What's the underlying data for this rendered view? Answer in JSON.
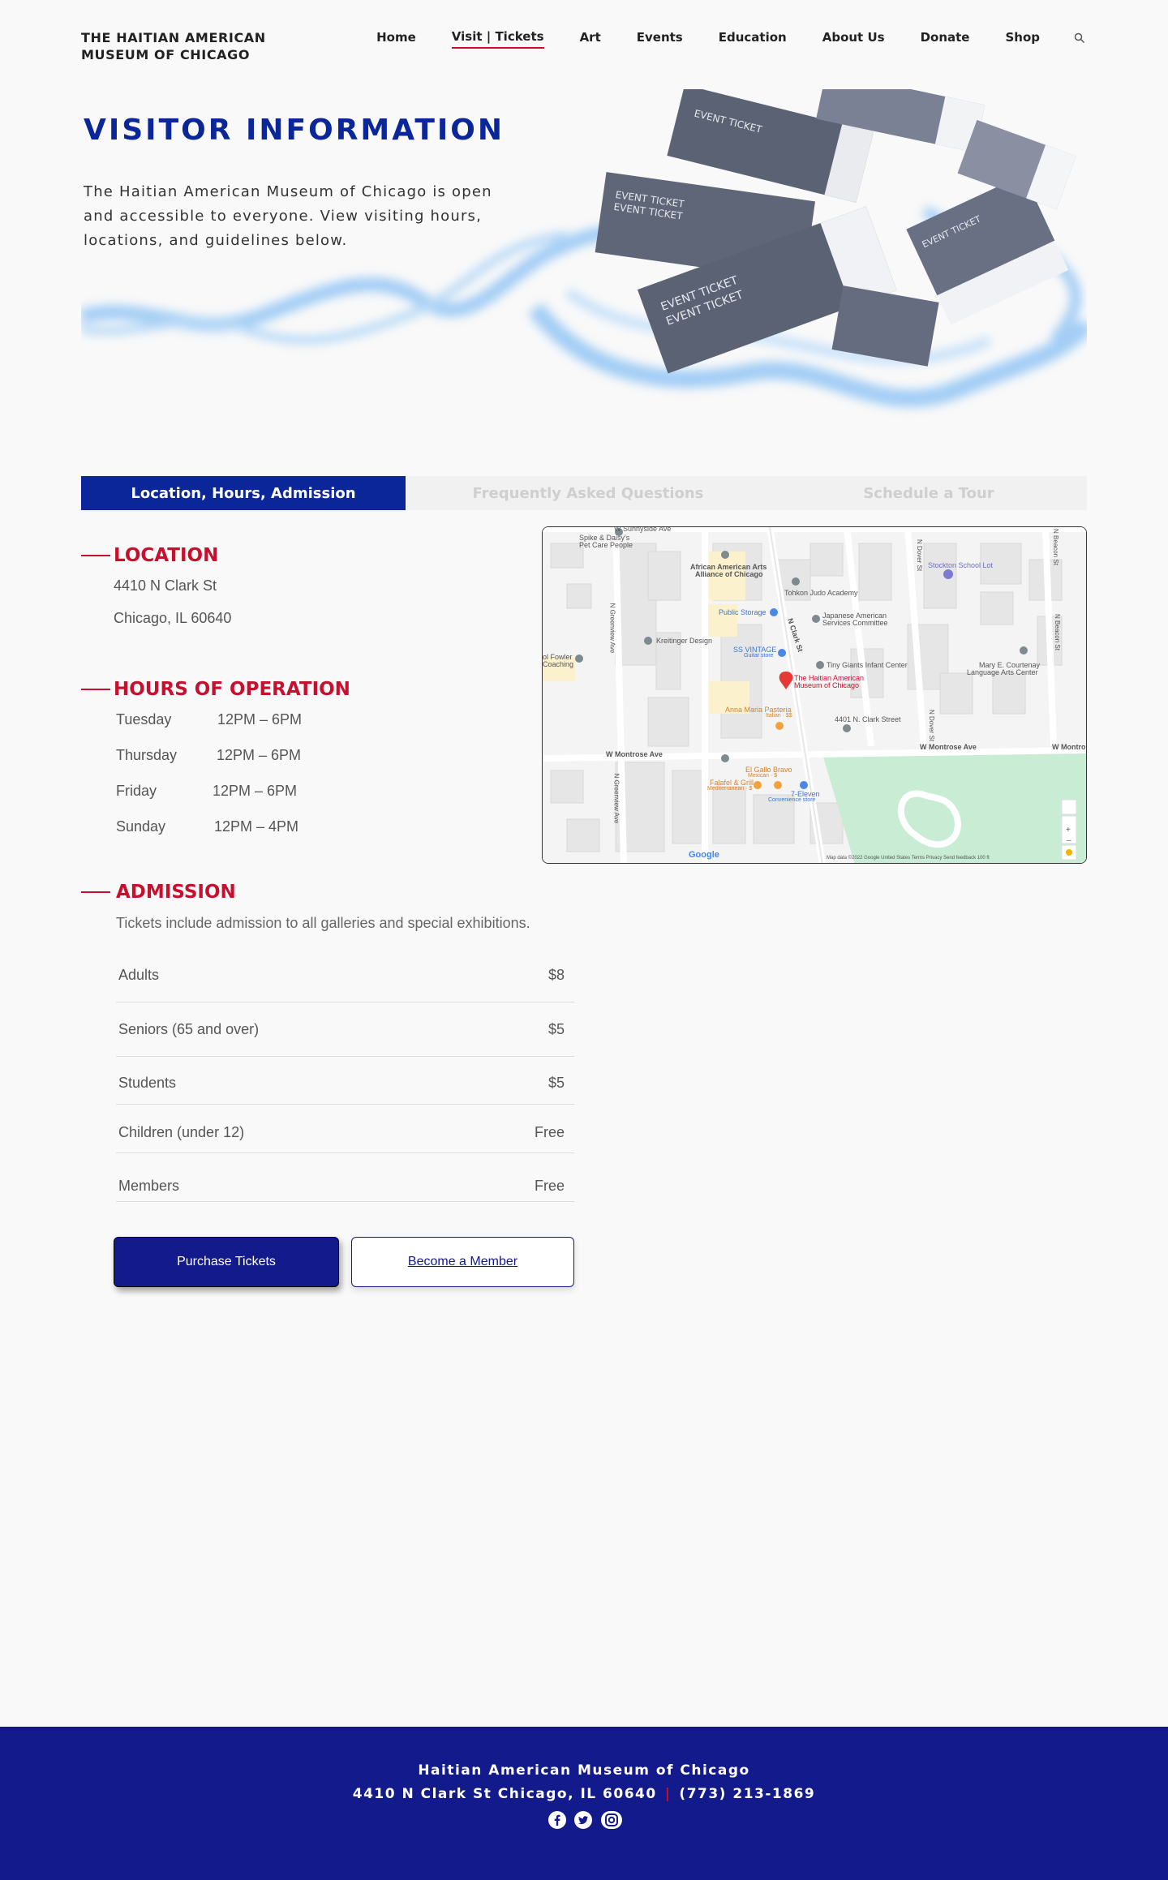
{
  "header": {
    "logo_line1": "THE HAITIAN AMERICAN",
    "logo_line2": "MUSEUM OF CHICAGO",
    "nav": [
      {
        "label": "Home"
      },
      {
        "label": "Visit | Tickets"
      },
      {
        "label": "Art"
      },
      {
        "label": "Events"
      },
      {
        "label": "Education"
      },
      {
        "label": "About Us"
      },
      {
        "label": "Donate"
      },
      {
        "label": "Shop"
      }
    ],
    "search_icon": "search-icon"
  },
  "hero": {
    "title": "VISITOR INFORMATION",
    "text": "The Haitian American Museum of Chicago is open and accessible to everyone. View visiting hours, locations, and guidelines below.",
    "ticket_text": "EVENT TICKET"
  },
  "tabs": [
    {
      "label": "Location, Hours, Admission"
    },
    {
      "label": "Frequently Asked Questions"
    },
    {
      "label": "Schedule a Tour"
    }
  ],
  "location": {
    "heading": "LOCATION",
    "line1": "4410 N Clark St",
    "line2": "Chicago, IL 60640"
  },
  "hours": {
    "heading": "HOURS OF OPERATION",
    "rows": [
      {
        "day": "Tuesday",
        "time": "12PM – 6PM"
      },
      {
        "day": "Thursday",
        "time": "12PM – 6PM"
      },
      {
        "day": "Friday",
        "time": "12PM – 6PM"
      },
      {
        "day": "Sunday",
        "time": "12PM – 4PM"
      }
    ]
  },
  "map": {
    "labels": {
      "sunnyside": "W Sunnyside Ave",
      "spike": "Spike & Daisy's",
      "spike2": "Pet Care People",
      "african": "African American Arts",
      "african2": "Alliance of Chicago",
      "tohkon": "Tohkon Judo Academy",
      "stockton": "Stockton School Lot",
      "storage": "Public Storage",
      "japanese": "Japanese American",
      "japanese2": "Services Committee",
      "kreitinger": "Kreitinger Design",
      "ssvintage": "SS VINTAGE",
      "ssvintage2": "Guitar store",
      "tiny": "Tiny Giants Infant Center",
      "courtenay": "Mary E. Courtenay",
      "courtenay2": "Language Arts Center",
      "museum": "The Haitian American",
      "museum2": "Museum of Chicago",
      "fowler": "ol Fowler",
      "fowler2": "Coaching",
      "anna": "Anna Maria Pasteria",
      "anna2": "Italian · $$",
      "clark4401": "4401 N. Clark Street",
      "montrose1": "W Montrose Ave",
      "montrose2": "W Montrose Ave",
      "montrose3": "W Montro",
      "gallo": "El Gallo Bravo",
      "gallo2": "Mexican · $",
      "falafel": "Falafel & Grill",
      "falafel2": "Mediterranean · $",
      "eleven": "7-Eleven",
      "eleven2": "Convenience store",
      "greenview1": "N Greenview Ave",
      "greenview2": "N Greenview Ave",
      "clarkst": "N Clark St",
      "dover1": "N Dover St",
      "dover2": "N Dover St",
      "beacon1": "N Beacon St",
      "beacon2": "N Beacon St",
      "google": "Google",
      "attribution": "Map data ©2022 Google   United States   Terms   Privacy   Send feedback   100 ft"
    }
  },
  "admission": {
    "heading": "ADMISSION",
    "subtitle": "Tickets include admission to all galleries and special exhibitions.",
    "prices": [
      {
        "name": "Adults",
        "price": "$8"
      },
      {
        "name": "Seniors (65 and over)",
        "price": "$5"
      },
      {
        "name": "Students",
        "price": "$5"
      },
      {
        "name": "Children (under 12)",
        "price": "Free"
      },
      {
        "name": "Members",
        "price": "Free"
      }
    ],
    "purchase_label": "Purchase Tickets",
    "member_label": "Become a Member"
  },
  "footer": {
    "name": "Haitian American Museum of Chicago",
    "address": "4410 N Clark St  Chicago, IL 60640",
    "phone": "(773) 213-1869",
    "social": [
      "facebook-icon",
      "twitter-icon",
      "instagram-icon"
    ]
  },
  "colors": {
    "brand_blue": "#0a2699",
    "footer_blue": "#131a8c",
    "accent_red": "#c8102e"
  }
}
